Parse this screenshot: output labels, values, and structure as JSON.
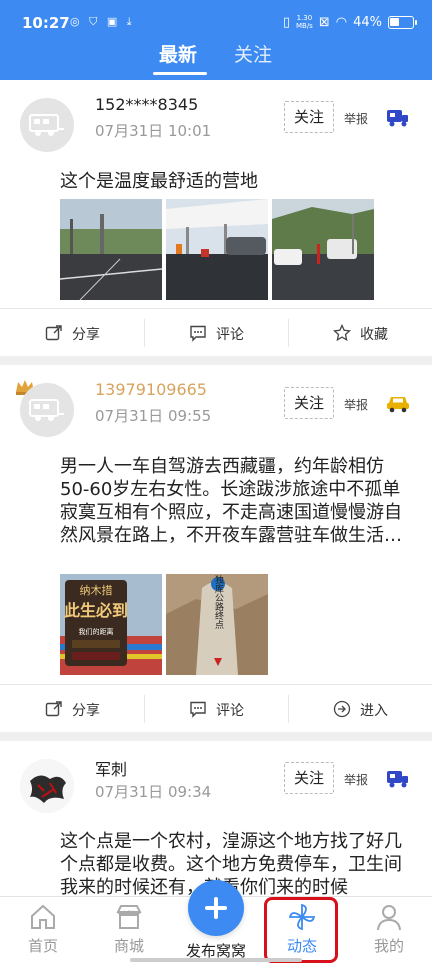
{
  "status_bar": {
    "time": "10:27",
    "speed_value": "1.30",
    "speed_unit": "MB/s",
    "battery": "44%",
    "battery_level": 0.44
  },
  "tabs": [
    {
      "label": "最新",
      "active": true
    },
    {
      "label": "关注",
      "active": false
    }
  ],
  "posts": [
    {
      "user": "152****8345",
      "time": "07月31日 10:01",
      "follow": "关注",
      "report": "举报",
      "content": "这个是温度最舒适的营地",
      "type_icon": "caravan-icon",
      "actions": [
        {
          "label": "分享",
          "icon": "share-icon"
        },
        {
          "label": "评论",
          "icon": "comment-icon"
        },
        {
          "label": "收藏",
          "icon": "star-icon"
        }
      ]
    },
    {
      "user": "13979109665",
      "time": "07月31日 09:55",
      "follow": "关注",
      "report": "举报",
      "content": "男一人一车自驾游去西藏疆，约年龄相仿50-60岁左右女性。长途跋涉旅途中不孤单寂寞互相有个照应，不走高速国道慢慢游自然风景在路上，不开夜车露营驻车做生活装备齐全，有想结伴而行可以联系我",
      "type_icon": "car-icon",
      "photo_texts": {
        "sign_top": "纳木措",
        "sign_main": "此生必到",
        "sign_sub": "我们的距离",
        "stone": "独库公路终点"
      },
      "actions": [
        {
          "label": "分享",
          "icon": "share-icon"
        },
        {
          "label": "评论",
          "icon": "comment-icon"
        },
        {
          "label": "进入",
          "icon": "enter-icon"
        }
      ]
    },
    {
      "user": "军刺",
      "time": "07月31日 09:34",
      "follow": "关注",
      "report": "举报",
      "content": "这个点是一个农村，湟源这个地方找了好几个点都是收费。这个地方免费停车，卫生间我来的时候还有，就看你们来的时候",
      "type_icon": "caravan-icon"
    }
  ],
  "bottom_nav": {
    "items": [
      {
        "label": "首页",
        "icon": "home-icon"
      },
      {
        "label": "商城",
        "icon": "shop-icon"
      },
      {
        "label": "动态",
        "icon": "pinwheel-icon",
        "active": true
      },
      {
        "label": "我的",
        "icon": "profile-icon"
      }
    ],
    "publish_label": "发布窝窝"
  },
  "colors": {
    "brand": "#3d8bf2",
    "gold": "#d6a45e",
    "highlight": "#d8101c"
  }
}
